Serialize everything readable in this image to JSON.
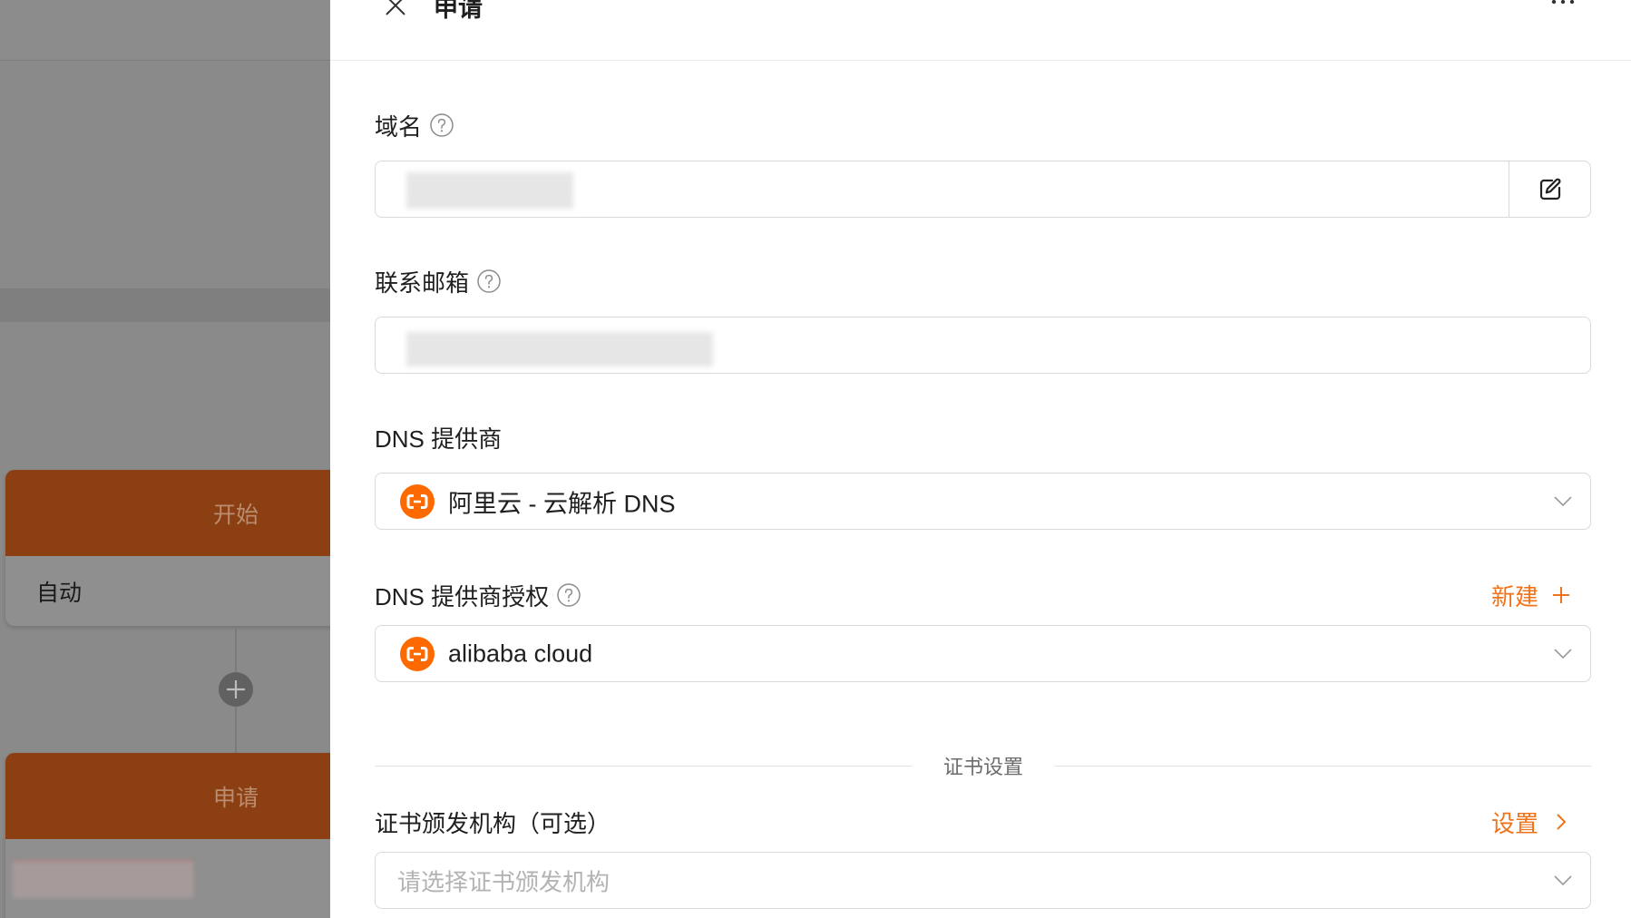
{
  "workflow": {
    "nodes": [
      {
        "title": "开始",
        "mode": "自动"
      },
      {
        "title": "申请"
      }
    ],
    "add_icon": "plus-circle-icon"
  },
  "drawer": {
    "title": "申请",
    "close_icon": "close-icon",
    "more_icon": "more-horizontal-icon"
  },
  "form": {
    "domain": {
      "label": "域名",
      "help_icon": "question-circle-icon",
      "addon_icon": "edit-icon"
    },
    "email": {
      "label": "联系邮箱",
      "help_icon": "question-circle-icon"
    },
    "dns_provider": {
      "label": "DNS 提供商",
      "value": "阿里云 - 云解析 DNS",
      "icon": "alibaba-cloud-icon"
    },
    "dns_credential": {
      "label": "DNS 提供商授权",
      "help_icon": "question-circle-icon",
      "value": "alibaba cloud",
      "icon": "alibaba-cloud-icon",
      "action_label": "新建",
      "action_icon": "plus-icon"
    },
    "certificate_section": "证书设置",
    "ca": {
      "label": "证书颁发机构（可选）",
      "placeholder": "请选择证书颁发机构",
      "action_label": "设置",
      "action_icon": "chevron-right-icon"
    }
  },
  "colors": {
    "accent": "#f0731a",
    "brand_icon": "#ff6a00",
    "node_header": "#8b3f12",
    "border": "#d9d9d9"
  }
}
